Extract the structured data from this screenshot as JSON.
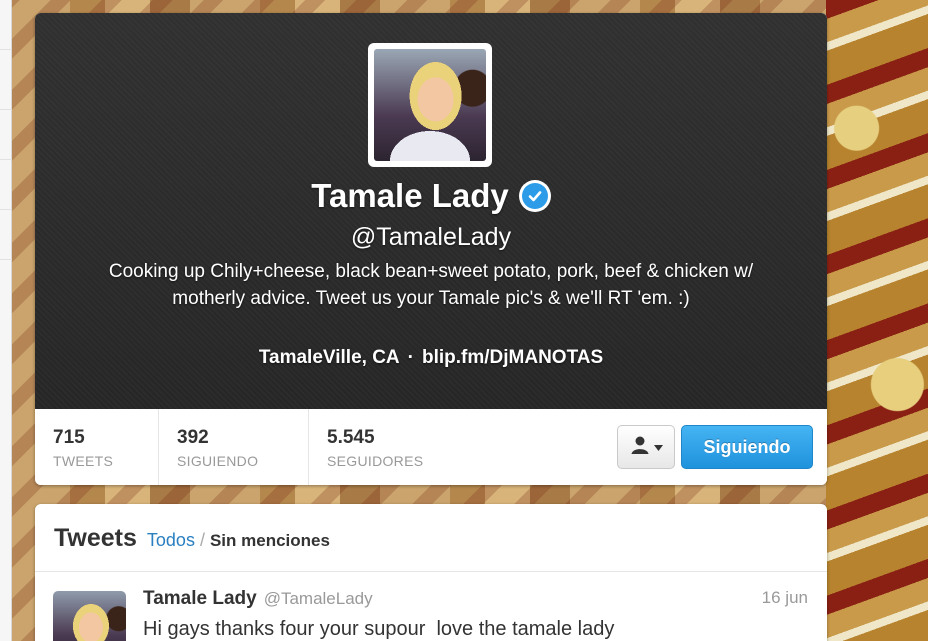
{
  "profile": {
    "name": "Tamale Lady",
    "screen_name": "@TamaleLady",
    "bio": "Cooking up Chily+cheese, black bean+sweet potato, pork, beef & chicken w/ motherly advice. Tweet us your Tamale pic's & we'll RT 'em. :)",
    "location": "TamaleVille, CA",
    "separator": "·",
    "url": "blip.fm/DjMANOTAS",
    "verified_icon": "verified-badge-icon"
  },
  "stats": [
    {
      "value": "715",
      "label": "TWEETS"
    },
    {
      "value": "392",
      "label": "SIGUIENDO"
    },
    {
      "value": "5.545",
      "label": "SEGUIDORES"
    }
  ],
  "actions": {
    "user_menu_icon": "person-dropdown-icon",
    "follow_label": "Siguiendo"
  },
  "tweets_section": {
    "title": "Tweets",
    "filter_all": "Todos",
    "filter_sep": "/",
    "filter_no_replies": "Sin menciones"
  },
  "tweets": [
    {
      "name": "Tamale Lady",
      "handle": "@TamaleLady",
      "date": "16 jun",
      "text": "Hi gays thanks four your supour  love the tamale lady"
    }
  ],
  "colors": {
    "accent": "#2a7fc1",
    "follow_button": "#2d9ce8",
    "header_bg": "#2b2b2b"
  }
}
